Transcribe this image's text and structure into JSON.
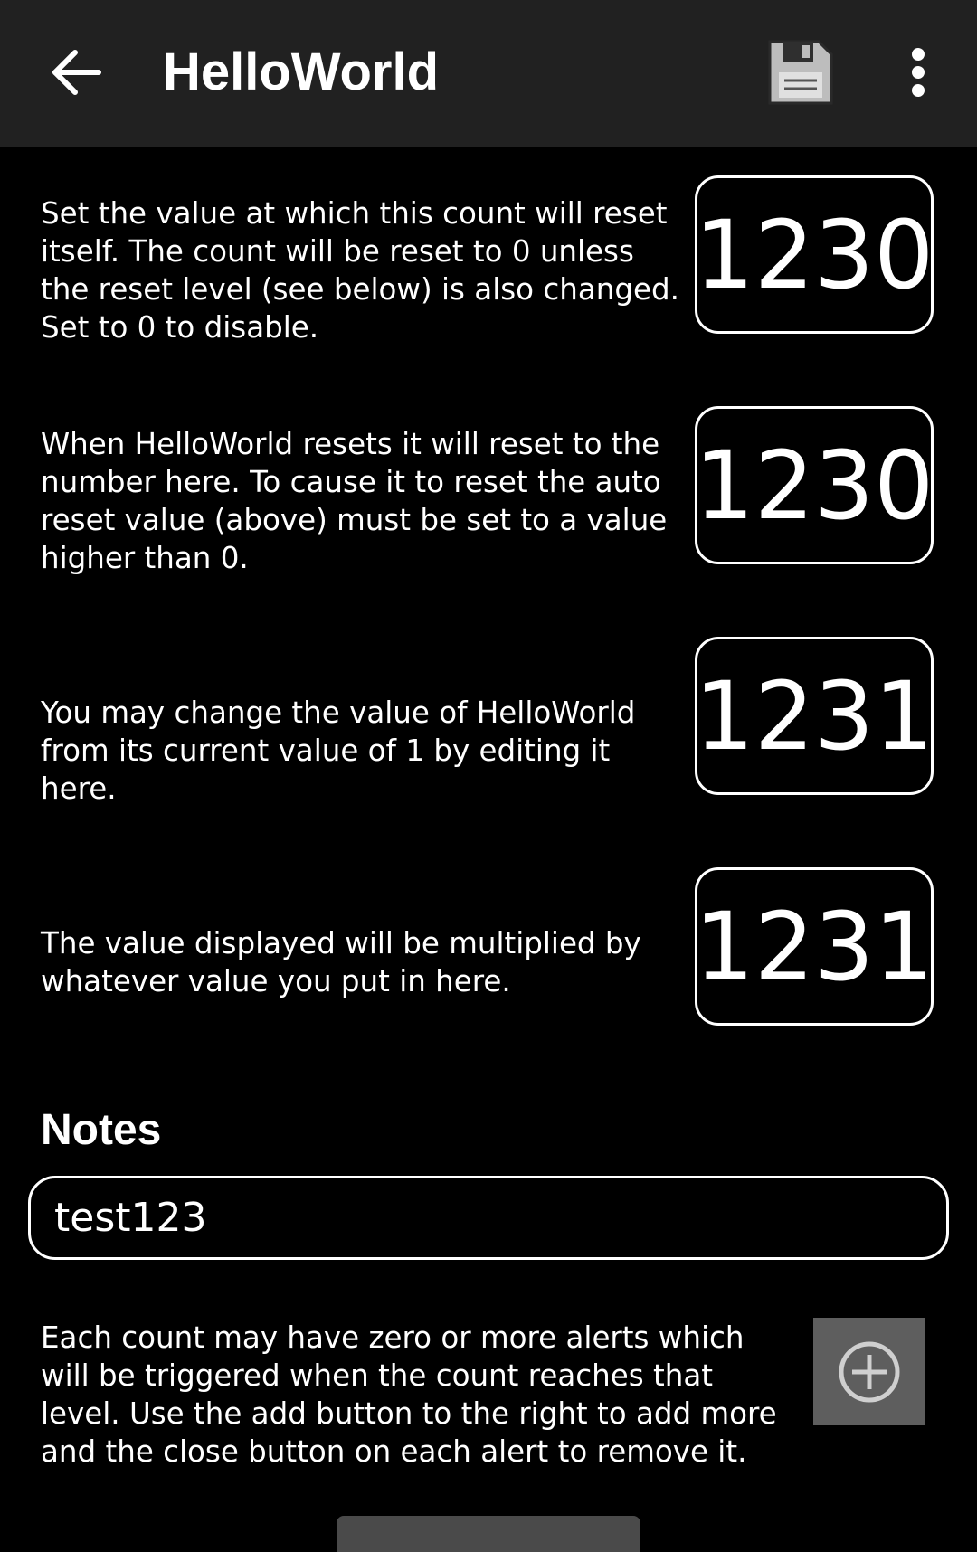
{
  "appbar": {
    "title": "HelloWorld",
    "back_icon": "arrow-left-icon",
    "save_icon": "floppy-disk-icon",
    "menu_icon": "more-vertical-icon"
  },
  "settings": [
    {
      "description": "Set the value at which this count will reset itself. The count will be reset to 0 unless the reset level (see below) is also changed. Set to 0 to disable.",
      "value": "1230"
    },
    {
      "description": "When HelloWorld resets it will reset to the number here. To cause it to reset the auto reset value (above) must be set to a value higher than 0.",
      "value": "1230"
    },
    {
      "description": "You may change the value of HelloWorld from its current value of 1 by editing it here.",
      "value": "1231"
    },
    {
      "description": "The value displayed will be multiplied by whatever value you put in here.",
      "value": "1231"
    }
  ],
  "notes": {
    "label": "Notes",
    "value": "test123"
  },
  "alerts": {
    "description": "Each count may have zero or more alerts which will be triggered when the count reaches that level. Use the add button to the right to add more and the close button on each alert to remove it.",
    "add_icon": "plus-circle-icon"
  }
}
